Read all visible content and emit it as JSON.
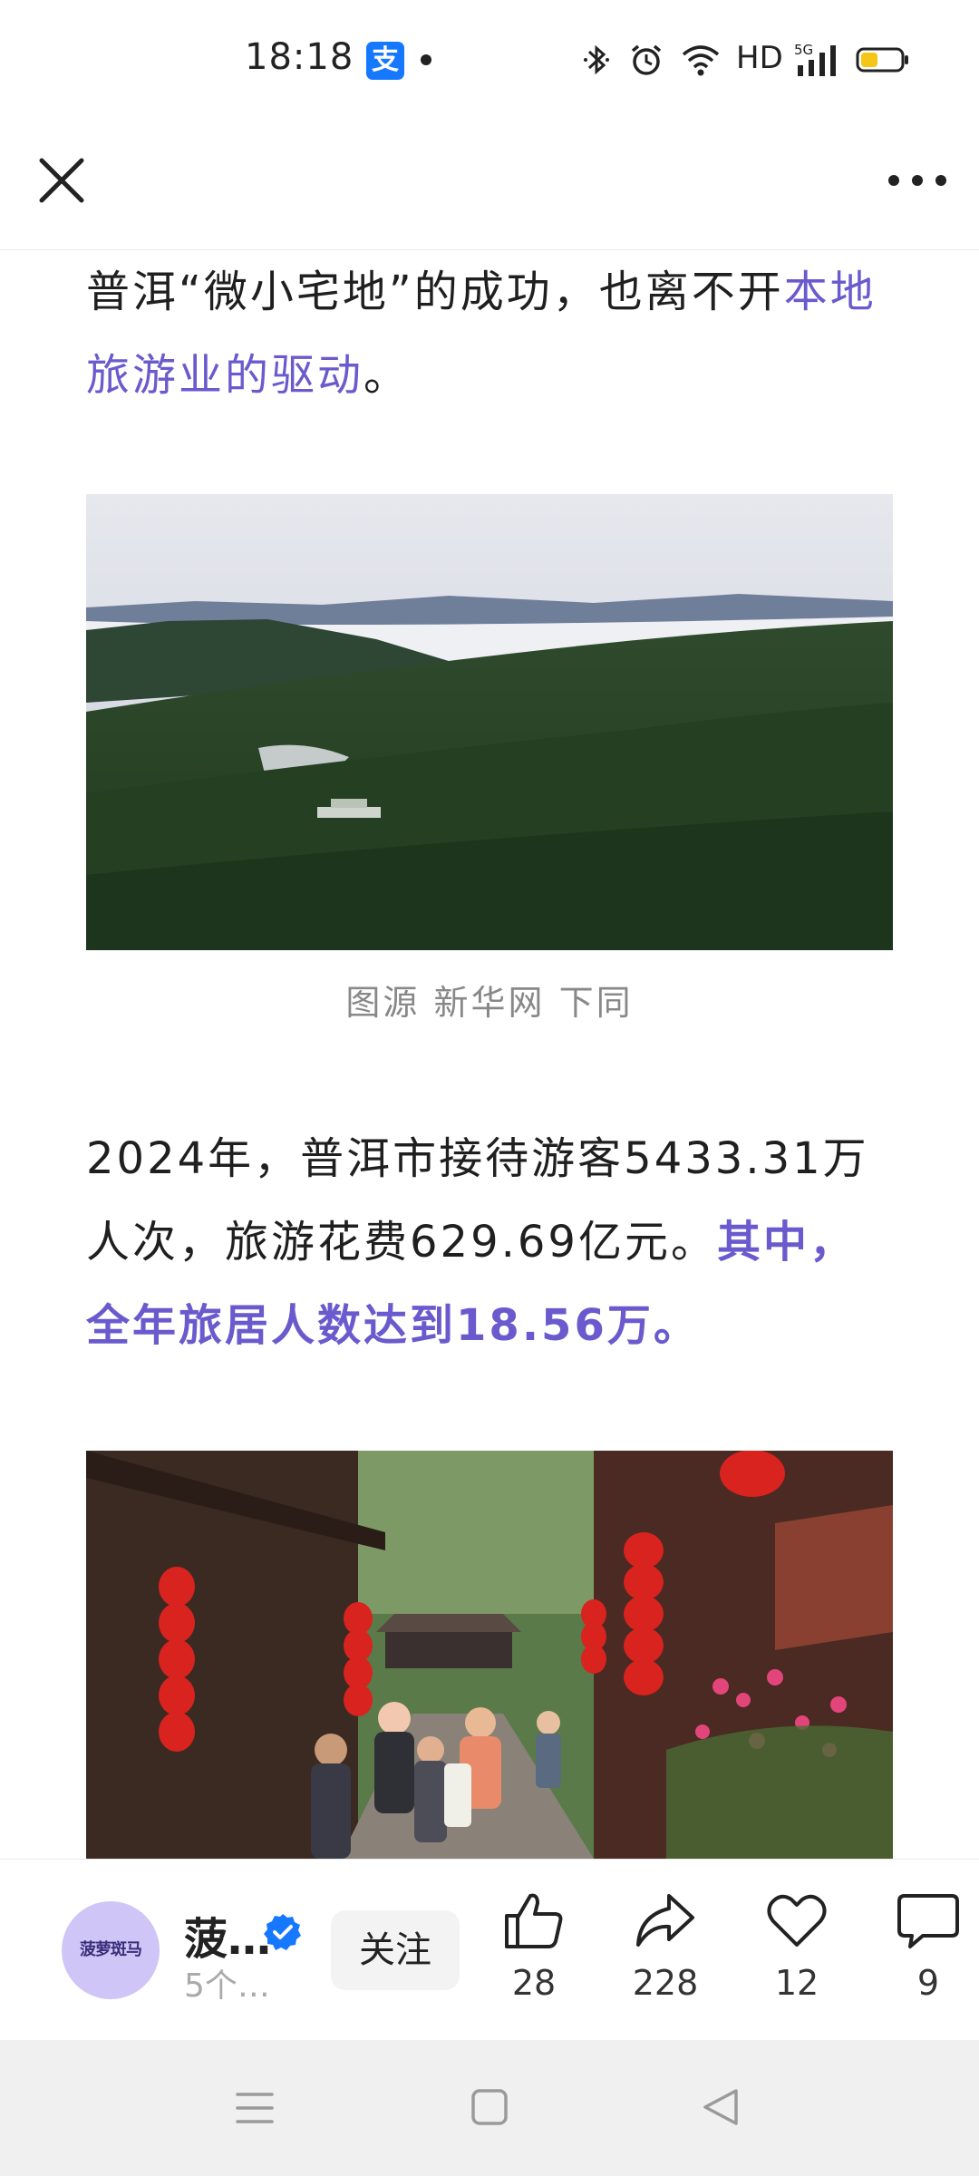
{
  "status_bar": {
    "time": "18:18",
    "alipay_badge": "支",
    "network_label": "HD",
    "signal_label": "5G"
  },
  "top_nav": {
    "close_icon": "close-icon",
    "more_icon": "more-horizontal-icon"
  },
  "article": {
    "para1_text": "普洱“微小宅地”的成功，也离不开",
    "para1_link": "本地旅游业的驱动",
    "para1_end": "。",
    "caption": "图源 新华网 下同",
    "para2_text": "2024年，普洱市接待游客5433.31万人次，旅游花费629.69亿元。",
    "para2_hl": "其中，全年旅居人数达到",
    "para2_num": "18.56",
    "para2_tail": "万。"
  },
  "author_bar": {
    "avatar_text": "菠萝斑马",
    "name": "菠…",
    "sub": "5个…",
    "follow_label": "关注",
    "actions": [
      {
        "icon": "thumbs-up-icon",
        "count": "28"
      },
      {
        "icon": "share-icon",
        "count": "228"
      },
      {
        "icon": "heart-icon",
        "count": "12"
      },
      {
        "icon": "comment-icon",
        "count": "9"
      }
    ]
  },
  "colors": {
    "highlight": "#6a5acd",
    "verified": "#1677ff",
    "avatar_bg": "#cfc6f7"
  }
}
